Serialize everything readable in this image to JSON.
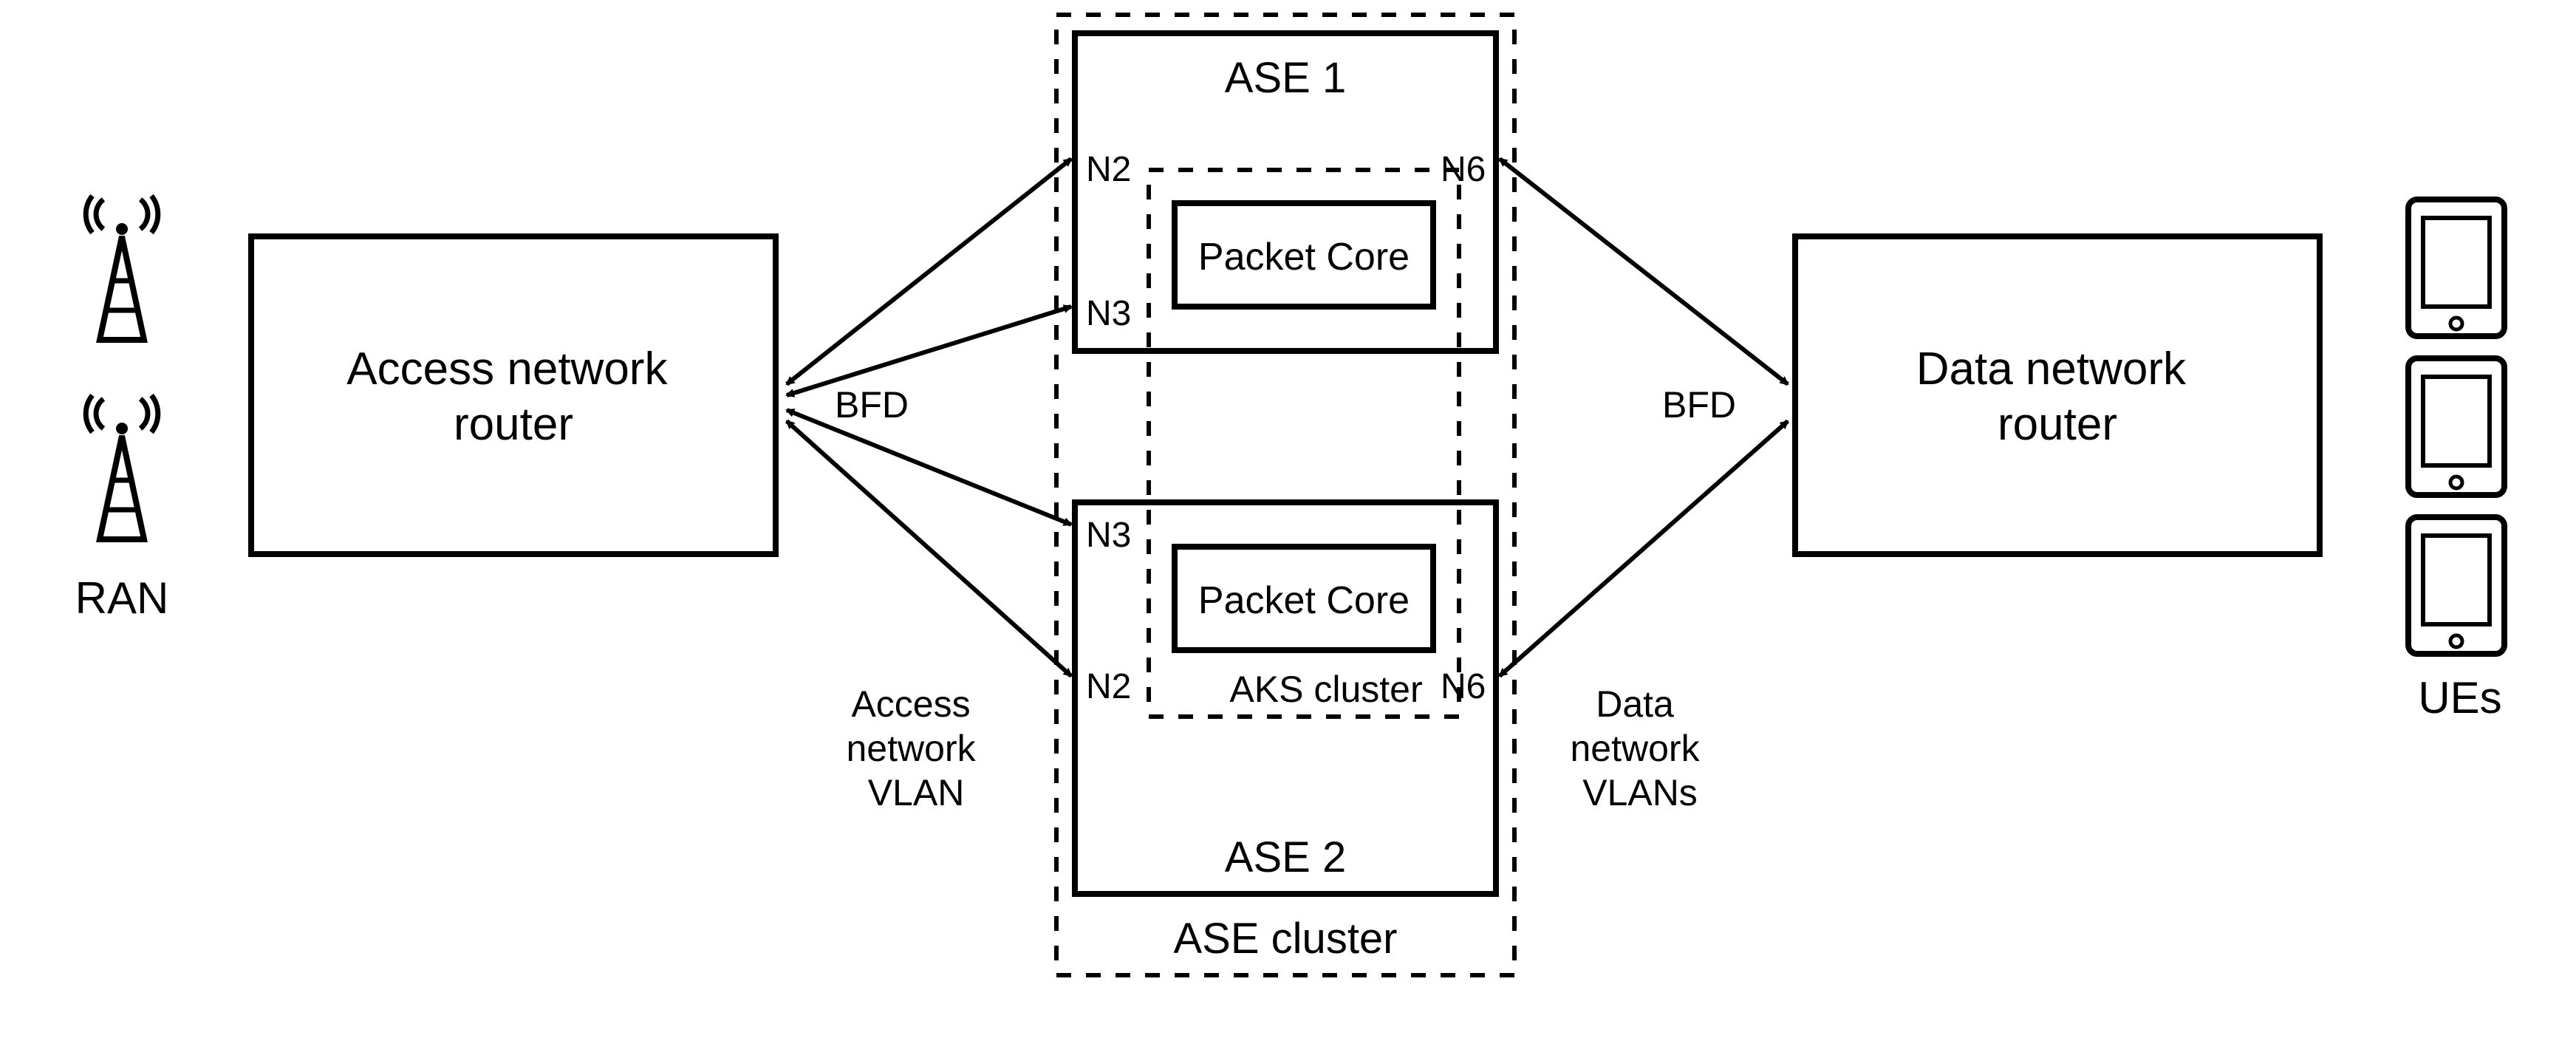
{
  "diagram": {
    "ran_label": "RAN",
    "ues_label": "UEs",
    "access_router": "Access network\nrouter",
    "data_router": "Data network\nrouter",
    "ase_cluster_label": "ASE cluster",
    "ase1": {
      "title": "ASE 1",
      "n2": "N2",
      "n3": "N3",
      "n6": "N6",
      "packet_core": "Packet Core"
    },
    "ase2": {
      "title": "ASE 2",
      "n2": "N2",
      "n3": "N3",
      "n6": "N6",
      "packet_core": "Packet Core",
      "aks_cluster": "AKS cluster"
    },
    "bfd_left": "BFD",
    "bfd_right": "BFD",
    "access_vlan": "Access\nnetwork\nVLAN",
    "data_vlan": "Data\nnetwork\nVLANs"
  }
}
